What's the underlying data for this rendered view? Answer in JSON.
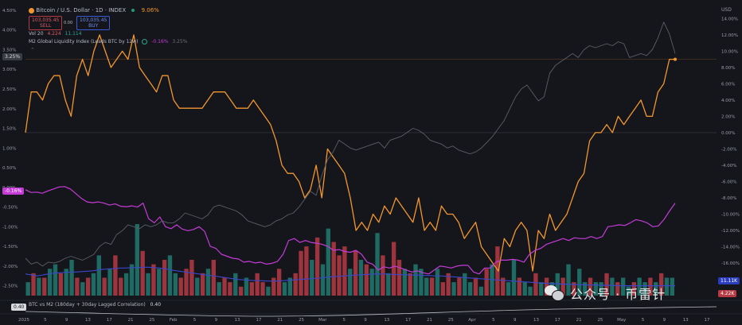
{
  "header": {
    "btc_icon": "bitcoin-icon",
    "title": "Bitcoin / U.S. Dollar · 1D · INDEX",
    "change_pct": "9.06%",
    "sell_price": "103,035.45",
    "sell_label": "SELL",
    "spread": "0.00",
    "buy_price": "103,035.45",
    "buy_label": "BUY",
    "vol_label": "Vol 20",
    "vol_red": "4.224",
    "vol_green": "11.114",
    "m2_label": "M2 Global Liquidity Index (Leads BTC by 12w)",
    "m2_value": "-0.16%",
    "m2_value2": "3.25%",
    "corr_label": "BTC vs M2 (180day + 30day Lagged Correlation)",
    "corr_value": "0.40",
    "corr_pill": "0.40"
  },
  "watermark": {
    "icon": "wechat-icon",
    "text": "公众号 · 币雷针"
  },
  "colors": {
    "bg": "#15161c",
    "btc": "#f2962e",
    "m2": "#c43bd6",
    "gray": "#5b5e66",
    "blue": "#3b46c9",
    "vol_up": "#1f7a70",
    "vol_down": "#b53a44",
    "text": "#9a9ea8"
  },
  "badges": {
    "left_top": "3.25%",
    "left_m2": "-0.16%",
    "usd": "USD",
    "right_vol_up": "11.11K",
    "right_vol_down": "4.22K"
  },
  "chart_data": {
    "type": "line",
    "left_axis": {
      "ticks": [
        "4.50%",
        "4.00%",
        "3.50%",
        "3.00%",
        "2.50%",
        "2.00%",
        "1.50%",
        "1.00%",
        "0.50%",
        "0.00%",
        "-0.50%",
        "-1.00%",
        "-1.50%",
        "-2.00%",
        "-2.50%"
      ],
      "ylim": [
        -2.75,
        4.6
      ]
    },
    "right_axis": {
      "ticks": [
        "14.00%",
        "12.00%",
        "10.00%",
        "8.00%",
        "6.00%",
        "4.00%",
        "2.00%",
        "0.00%",
        "-2.00%",
        "-4.00%",
        "-6.00%",
        "-8.00%",
        "-10.00%",
        "-12.00%",
        "-14.00%",
        "-16.00%",
        "-18.00%"
      ],
      "ylim": [
        -20,
        15.5
      ]
    },
    "x_ticks": [
      "2025",
      "5",
      "9",
      "13",
      "17",
      "21",
      "25",
      "Feb",
      "5",
      "9",
      "13",
      "17",
      "21",
      "25",
      "Mar",
      "5",
      "9",
      "13",
      "17",
      "21",
      "25",
      "Apr",
      "5",
      "9",
      "13",
      "17",
      "21",
      "25",
      "May",
      "5",
      "9",
      "13",
      "17"
    ],
    "series": [
      {
        "axis": "right",
        "values": [
          0,
          5,
          5,
          4,
          6,
          7,
          7,
          4,
          2,
          7,
          9,
          7,
          10,
          12,
          10,
          8,
          9,
          10,
          9,
          12,
          8,
          7,
          6,
          5,
          7,
          7,
          4,
          3,
          3,
          3,
          3,
          3,
          4,
          5,
          5,
          5,
          4,
          3,
          3,
          3,
          4,
          3,
          2,
          1,
          -1,
          -4,
          -5,
          -5,
          -6,
          -8,
          -7,
          -4,
          -8,
          -2,
          -3,
          -4,
          -5,
          -8,
          -12,
          -11,
          -12,
          -10,
          -11,
          -9,
          -10,
          -8,
          -9,
          -10,
          -11,
          -8,
          -12,
          -11,
          -12,
          -9,
          -10,
          -10,
          -11,
          -13,
          -12,
          -11,
          -14,
          -15,
          -16,
          -17,
          -13,
          -14,
          -12,
          -11,
          -12,
          -17,
          -12,
          -13,
          -10,
          -12,
          -11,
          -10,
          -8,
          -6,
          -5,
          -1,
          0,
          0,
          1,
          0,
          2,
          1,
          2,
          3,
          4,
          2,
          2,
          5,
          6,
          9,
          9
        ]
      },
      {
        "axis": "left",
        "values": [
          -0.06,
          -0.13,
          -0.12,
          -0.15,
          -0.09,
          -0.04,
          0.01,
          0.02,
          -0.04,
          -0.16,
          -0.28,
          -0.37,
          -0.39,
          -0.37,
          -0.4,
          -0.45,
          -0.42,
          -0.48,
          -0.49,
          -0.47,
          -0.5,
          -0.4,
          -0.8,
          -0.9,
          -0.75,
          -1.0,
          -1.05,
          -0.95,
          -1.06,
          -1.1,
          -1.07,
          -1.0,
          -1.12,
          -1.5,
          -1.55,
          -1.7,
          -1.75,
          -1.8,
          -1.82,
          -1.9,
          -1.88,
          -1.92,
          -1.9,
          -1.95,
          -1.93,
          -1.88,
          -1.7,
          -1.35,
          -1.3,
          -1.4,
          -1.35,
          -1.4,
          -1.42,
          -1.45,
          -1.5,
          -1.6,
          -1.58,
          -1.63,
          -1.65,
          -1.6,
          -1.7,
          -1.9,
          -1.95,
          -2.1,
          -2.02,
          -2.05,
          -2.0,
          -2.05,
          -2.1,
          -2.15,
          -2.12,
          -2.17,
          -2.2,
          -2.1,
          -2.0,
          -2.02,
          -2.05,
          -2.0,
          -1.98,
          -1.98,
          -2.15,
          -2.2,
          -2.05,
          -2.05,
          -1.9,
          -1.85,
          -1.85,
          -1.83,
          -1.85,
          -1.9,
          -1.7,
          -1.6,
          -1.55,
          -1.45,
          -1.4,
          -1.35,
          -1.3,
          -1.35,
          -1.28,
          -1.3,
          -1.3,
          -1.25,
          -1.3,
          -1.25,
          -1.0,
          -0.98,
          -0.95,
          -0.97,
          -0.9,
          -0.82,
          -0.85,
          -0.9,
          -1.0,
          -0.98,
          -0.82,
          -0.6,
          -0.4
        ]
      },
      {
        "axis": "left",
        "values": [
          -1.8,
          -1.95,
          -1.9,
          -2.0,
          -1.9,
          -1.92,
          -1.88,
          -1.8,
          -1.75,
          -1.8,
          -1.85,
          -1.78,
          -1.7,
          -1.5,
          -1.4,
          -1.45,
          -1.2,
          -1.1,
          -0.95,
          -1.0,
          -1.05,
          -0.95,
          -1.0,
          -0.95,
          -0.85,
          -0.9,
          -0.9,
          -0.8,
          -0.65,
          -0.7,
          -0.75,
          -0.8,
          -0.7,
          -0.5,
          -0.45,
          -0.5,
          -0.55,
          -0.6,
          -0.7,
          -0.85,
          -0.9,
          -0.95,
          -1.0,
          -0.95,
          -0.85,
          -0.8,
          -0.7,
          -0.65,
          -0.5,
          -0.3,
          -0.1,
          -0.2,
          0.3,
          0.7,
          0.9,
          1.2,
          1.1,
          1.0,
          0.95,
          1.0,
          1.05,
          1.1,
          1.15,
          1.0,
          1.2,
          1.25,
          1.3,
          1.4,
          1.5,
          1.45,
          1.35,
          1.2,
          1.15,
          1.1,
          1.0,
          1.05,
          0.95,
          0.9,
          0.85,
          0.9,
          1.0,
          1.15,
          1.3,
          1.5,
          1.7,
          2.0,
          2.3,
          2.5,
          2.6,
          2.4,
          2.2,
          2.3,
          2.9,
          3.1,
          3.2,
          3.3,
          3.4,
          3.3,
          3.5,
          3.6,
          3.55,
          3.6,
          3.65,
          3.6,
          3.7,
          3.65,
          3.3,
          3.35,
          3.4,
          3.35,
          3.5,
          3.8,
          4.2,
          3.9,
          3.4
        ]
      },
      {
        "axis": "left",
        "values": [
          -2.2,
          -2.22,
          -2.25,
          -2.23,
          -2.2,
          -2.18,
          -2.17,
          -2.16,
          -2.15,
          -2.15,
          -2.14,
          -2.13,
          -2.12,
          -2.1,
          -2.08,
          -2.07,
          -2.06,
          -2.05,
          -2.05,
          -2.04,
          -2.04,
          -2.03,
          -2.03,
          -2.04,
          -2.05,
          -2.07,
          -2.1,
          -2.12,
          -2.14,
          -2.16,
          -2.18,
          -2.2,
          -2.22,
          -2.24,
          -2.26,
          -2.28,
          -2.3,
          -2.32,
          -2.34,
          -2.35,
          -2.36,
          -2.37,
          -2.37,
          -2.38,
          -2.38,
          -2.38,
          -2.37,
          -2.36,
          -2.35,
          -2.34,
          -2.33,
          -2.32,
          -2.31,
          -2.3,
          -2.28,
          -2.27,
          -2.26,
          -2.25,
          -2.24,
          -2.23,
          -2.22,
          -2.21,
          -2.2,
          -2.2,
          -2.2,
          -2.21,
          -2.21,
          -2.22,
          -2.22,
          -2.23,
          -2.23,
          -2.24,
          -2.24,
          -2.25,
          -2.25,
          -2.26,
          -2.27,
          -2.28,
          -2.29,
          -2.3,
          -2.31,
          -2.32,
          -2.33,
          -2.34,
          -2.35,
          -2.36,
          -2.37,
          -2.38,
          -2.39,
          -2.4,
          -2.41,
          -2.42,
          -2.43,
          -2.44,
          -2.45,
          -2.45,
          -2.46,
          -2.46,
          -2.47,
          -2.47,
          -2.48,
          -2.48,
          -2.48,
          -2.49,
          -2.49,
          -2.49,
          -2.5,
          -2.5,
          -2.5,
          -2.5,
          -2.5,
          -2.5,
          -2.5,
          -2.5,
          -2.5,
          -2.5,
          -2.5
        ]
      }
    ],
    "volume": {
      "values": [
        3,
        5,
        4,
        4,
        6,
        7,
        5,
        6,
        8,
        4,
        3,
        4,
        5,
        9,
        4,
        6,
        9,
        4,
        5,
        7,
        16,
        10,
        5,
        7,
        6,
        8,
        9,
        5,
        4,
        6,
        8,
        4,
        5,
        6,
        8,
        3,
        4,
        3,
        5,
        2,
        4,
        3,
        5,
        3,
        2,
        4,
        6,
        3,
        4,
        5,
        10,
        11,
        8,
        13,
        7,
        15,
        12,
        9,
        11,
        6,
        10,
        8,
        7,
        6,
        14,
        9,
        5,
        12,
        8,
        6,
        5,
        7,
        6,
        4,
        4,
        6,
        3,
        5,
        3,
        4,
        5,
        3,
        4,
        2,
        6,
        7,
        11,
        4,
        3,
        8,
        4,
        3,
        2,
        5,
        3,
        4,
        3,
        5,
        4,
        7,
        3,
        6,
        3,
        4,
        3,
        3,
        5,
        4,
        3,
        4,
        2,
        3,
        4,
        3,
        4,
        3,
        5,
        4,
        4
      ],
      "up": [
        1,
        0,
        1,
        0,
        1,
        1,
        0,
        1,
        1,
        0,
        1,
        0,
        1,
        1,
        0,
        1,
        0,
        0,
        1,
        1,
        1,
        0,
        1,
        0,
        1,
        0,
        1,
        1,
        0,
        0,
        0,
        1,
        0,
        1,
        0,
        1,
        0,
        0,
        1,
        0,
        1,
        0,
        0,
        0,
        1,
        0,
        0,
        1,
        1,
        0,
        0,
        0,
        1,
        0,
        1,
        1,
        0,
        0,
        0,
        1,
        0,
        1,
        0,
        1,
        1,
        0,
        1,
        0,
        0,
        1,
        0,
        1,
        1,
        1,
        0,
        1,
        0,
        0,
        1,
        0,
        1,
        1,
        0,
        1,
        0,
        1,
        0,
        0,
        1,
        1,
        0,
        1,
        1,
        0,
        1,
        0,
        1,
        1,
        0,
        1,
        0,
        1,
        1,
        0,
        1,
        1,
        0,
        1,
        0,
        1,
        1,
        0,
        1,
        1,
        0,
        1,
        0,
        1,
        1
      ]
    }
  }
}
